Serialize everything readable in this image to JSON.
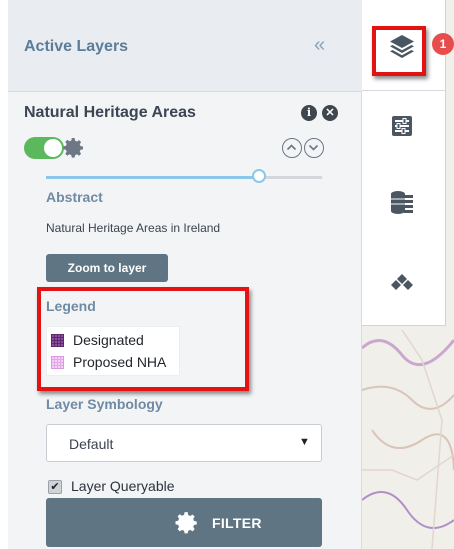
{
  "panel": {
    "title": "Active Layers",
    "collapse_icon": "double-chevron-left-icon",
    "layer": {
      "name": "Natural Heritage Areas",
      "visible": true,
      "opacity": 0.77,
      "info_glyph": "i",
      "close_glyph": "✕",
      "abstract_heading": "Abstract",
      "abstract_text": "Natural Heritage Areas in Ireland",
      "zoom_button": "Zoom to layer",
      "legend_heading": "Legend",
      "legend": [
        {
          "label": "Designated",
          "color": "#7b3b8f"
        },
        {
          "label": "Proposed NHA",
          "color": "#e7b6ef"
        }
      ],
      "symbology_heading": "Layer Symbology",
      "symbology_value": "Default",
      "queryable_checked": true,
      "queryable_label": "Layer Queryable",
      "filter_button": "FILTER"
    }
  },
  "toolbar": {
    "badge_count": "1",
    "buttons": [
      "layers-icon",
      "sliders-icon",
      "database-list-icon",
      "diamond-stack-icon"
    ]
  },
  "colors": {
    "accent_blue": "#5b7d98",
    "button_slate": "#5f7584",
    "toggle_green": "#5cb85c",
    "highlight_red": "#e41313",
    "badge_red": "#e84d4d"
  }
}
